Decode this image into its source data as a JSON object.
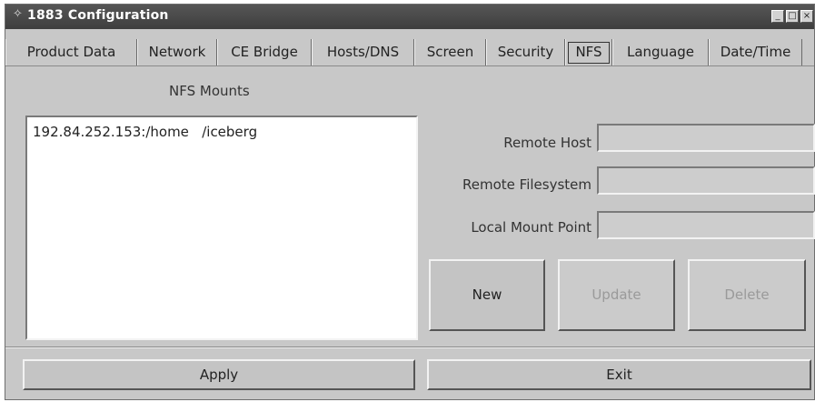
{
  "window": {
    "title": "1883 Configuration"
  },
  "tabs": [
    {
      "label": "Product Data"
    },
    {
      "label": "Network"
    },
    {
      "label": "CE Bridge"
    },
    {
      "label": "Hosts/DNS"
    },
    {
      "label": "Screen"
    },
    {
      "label": "Security"
    },
    {
      "label": "NFS",
      "active": true
    },
    {
      "label": "Language"
    },
    {
      "label": "Date/Time"
    }
  ],
  "nfs": {
    "section_title": "NFS Mounts",
    "mounts": [
      "192.84.252.153:/home   /iceberg"
    ],
    "labels": {
      "remote_host": "Remote Host",
      "remote_filesystem": "Remote Filesystem",
      "local_mount_point": "Local Mount Point"
    },
    "values": {
      "remote_host": "",
      "remote_filesystem": "",
      "local_mount_point": ""
    },
    "buttons": {
      "new": "New",
      "update": "Update",
      "delete": "Delete"
    }
  },
  "footer": {
    "apply": "Apply",
    "exit": "Exit"
  }
}
